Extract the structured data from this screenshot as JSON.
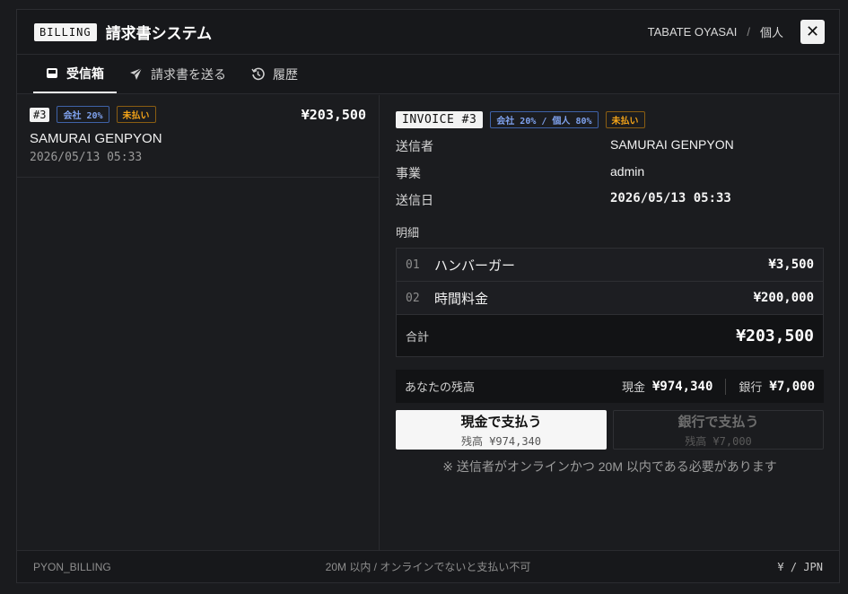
{
  "header": {
    "badge": "BILLING",
    "title": "請求書システム",
    "user": "TABATE OYASAI",
    "separator": "/",
    "account_type": "個人",
    "close_glyph": "✕"
  },
  "tabs": [
    {
      "label": "受信箱",
      "icon": "inbox-icon",
      "active": true
    },
    {
      "label": "請求書を送る",
      "icon": "send-icon",
      "active": false
    },
    {
      "label": "履歴",
      "icon": "history-icon",
      "active": false
    }
  ],
  "inbox": {
    "items": [
      {
        "number": "#3",
        "split_tag": "会社 20%",
        "status": "未払い",
        "amount": "¥203,500",
        "sender": "SAMURAI GENPYON",
        "date": "2026/05/13 05:33"
      }
    ]
  },
  "detail": {
    "title": "INVOICE #3",
    "split_tag": "会社 20% / 個人 80%",
    "status": "未払い",
    "meta": [
      {
        "key": "送信者",
        "value": "SAMURAI GENPYON"
      },
      {
        "key": "事業",
        "value": "admin"
      },
      {
        "key": "送信日",
        "value": "2026/05/13 05:33"
      }
    ],
    "lines_label": "明細",
    "lines": [
      {
        "no": "01",
        "name": "ハンバーガー",
        "amount": "¥3,500"
      },
      {
        "no": "02",
        "name": "時間料金",
        "amount": "¥200,000"
      }
    ],
    "total_label": "合計",
    "total": "¥203,500"
  },
  "balance": {
    "label": "あなたの残高",
    "cash_label": "現金",
    "cash": "¥974,340",
    "bank_label": "銀行",
    "bank": "¥7,000"
  },
  "pay": {
    "cash_button": "現金で支払う",
    "cash_sub": "残高 ¥974,340",
    "bank_button": "銀行で支払う",
    "bank_sub": "残高 ¥7,000",
    "note": "※ 送信者がオンラインかつ 20M 以内である必要があります"
  },
  "footer": {
    "left": "PYON_BILLING",
    "center": "20M 以内 / オンラインでないと支払い不可",
    "right": "¥ / JPN"
  },
  "colors": {
    "background": "#1b1c1f",
    "accent_blue": "#7fa2ee",
    "accent_orange": "#f3a318",
    "button_primary": "#f6f6f6"
  }
}
